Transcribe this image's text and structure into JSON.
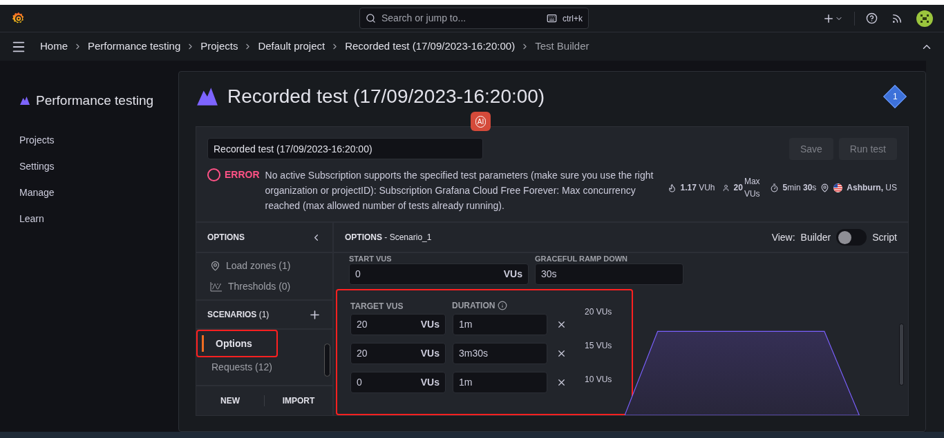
{
  "topbar": {
    "search_placeholder": "Search or jump to...",
    "shortcut": "ctrl+k"
  },
  "breadcrumbs": [
    {
      "label": "Home",
      "current": false
    },
    {
      "label": "Performance testing",
      "current": false
    },
    {
      "label": "Projects",
      "current": false
    },
    {
      "label": "Default project",
      "current": false
    },
    {
      "label": "Recorded test (17/09/2023-16:20:00)",
      "current": false
    },
    {
      "label": "Test Builder",
      "current": true
    }
  ],
  "sidebar": {
    "title": "Performance testing",
    "items": [
      {
        "label": "Projects"
      },
      {
        "label": "Settings"
      },
      {
        "label": "Manage"
      },
      {
        "label": "Learn"
      }
    ]
  },
  "page": {
    "title": "Recorded test (17/09/2023-16:20:00)",
    "badge": "1",
    "ai_badge": "AI"
  },
  "test_name": {
    "value": "Recorded test (17/09/2023-16:20:00)"
  },
  "actions": [
    {
      "label": "Save",
      "disabled": true
    },
    {
      "label": "Run test",
      "disabled": true
    }
  ],
  "error": {
    "label": "ERROR",
    "message": "No active Subscription supports the specified test parameters (make sure you use the right organization or projectID): Subscription Grafana Cloud Free Forever: Max concurrency reached (max allowed number of tests already running)."
  },
  "stats": {
    "vuh_value": "1.17",
    "vuh_unit": "VUh",
    "vus_value": "20",
    "vus_unit_top": "Max",
    "vus_unit_bottom": "VUs",
    "duration_min": "5",
    "duration_min_unit": "min",
    "duration_sec": "30",
    "duration_sec_unit": "s",
    "city": "Ashburn,",
    "country": "US"
  },
  "options_panel": {
    "title": "OPTIONS",
    "items": [
      {
        "label": "Load zones (1)",
        "kind": "zones"
      },
      {
        "label": "Thresholds (0)",
        "kind": "thresholds"
      }
    ],
    "scenarios_title": "SCENARIOS",
    "scenarios_count": "(1)",
    "scenarios": [
      {
        "label": "Options",
        "selected": true,
        "annotated": true
      },
      {
        "label": "Requests (12)",
        "selected": false,
        "annotated": false
      }
    ],
    "footer": [
      "NEW",
      "IMPORT"
    ]
  },
  "editor": {
    "title": "OPTIONS",
    "subtitle": "- Scenario_1",
    "view_label": "View:",
    "view_left": "Builder",
    "view_right": "Script",
    "script_on": false,
    "start_vus_label": "START VUS",
    "start_vus": "0",
    "start_vus_unit": "VUs",
    "ramp_down_label": "GRACEFUL RAMP DOWN",
    "ramp_down": "30s",
    "stages_annotated": true,
    "target_label": "TARGET VUS",
    "duration_label": "DURATION",
    "stages": [
      {
        "target": "20",
        "unit": "VUs",
        "duration": "1m"
      },
      {
        "target": "20",
        "unit": "VUs",
        "duration": "3m30s"
      },
      {
        "target": "0",
        "unit": "VUs",
        "duration": "1m"
      }
    ],
    "chart_ticks": [
      "20 VUs",
      "15 VUs",
      "10 VUs"
    ]
  }
}
